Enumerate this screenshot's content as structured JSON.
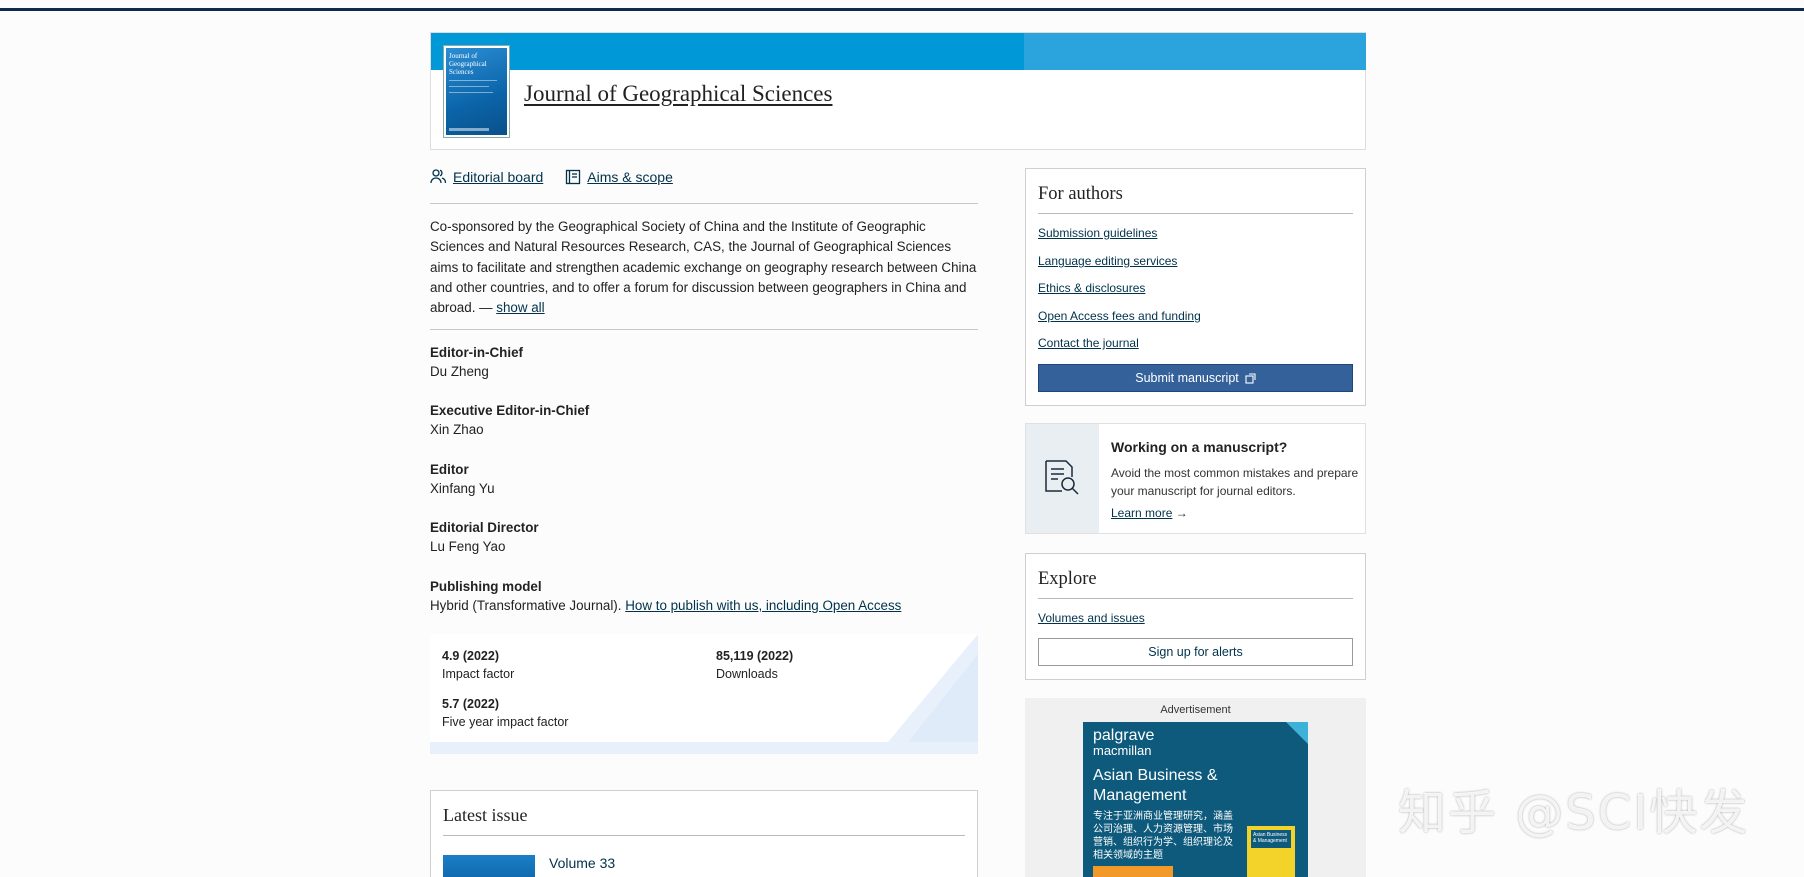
{
  "journal": {
    "title": "Journal of Geographical Sciences",
    "cover_text": "Journal of Geographical Sciences"
  },
  "nav_links": [
    {
      "label": "Editorial board",
      "icon": "people-icon"
    },
    {
      "label": "Aims & scope",
      "icon": "book-icon"
    }
  ],
  "description": {
    "text": "Co-sponsored by the Geographical Society of China and the Institute of Geographic Sciences and Natural Resources Research, CAS, the Journal of Geographical Sciences aims to facilitate and strengthen academic exchange on geography research between China and other countries, and to offer a forum for discussion between geographers in China and abroad. — ",
    "show_all": "show all"
  },
  "editors": [
    {
      "label": "Editor-in-Chief",
      "value": "Du Zheng"
    },
    {
      "label": "Executive Editor-in-Chief",
      "value": "Xin Zhao"
    },
    {
      "label": "Editor",
      "value": "Xinfang Yu"
    },
    {
      "label": "Editorial Director",
      "value": "Lu Feng Yao"
    }
  ],
  "publishing_model": {
    "label": "Publishing model",
    "value": "Hybrid (Transformative Journal). ",
    "link": "How to publish with us, including Open Access"
  },
  "metrics": [
    {
      "value": "4.9 (2022)",
      "label": "Impact factor"
    },
    {
      "value": "85,119 (2022)",
      "label": "Downloads"
    },
    {
      "value": "5.7 (2022)",
      "label": "Five year impact factor"
    }
  ],
  "latest_issue": {
    "heading": "Latest issue",
    "volume": "Volume 33"
  },
  "for_authors": {
    "heading": "For authors",
    "links": [
      "Submission guidelines",
      "Language editing services",
      "Ethics & disclosures",
      "Open Access fees and funding",
      "Contact the journal"
    ],
    "submit_label": "Submit manuscript"
  },
  "working_manuscript": {
    "title": "Working on a manuscript?",
    "text": "Avoid the most common mistakes and prepare your manuscript for journal editors.",
    "learn_more": "Learn more",
    "arrow": "→"
  },
  "explore": {
    "heading": "Explore",
    "link": "Volumes and issues",
    "alerts_label": "Sign up for alerts"
  },
  "advertisement": {
    "label": "Advertisement",
    "brand_line1": "palgrave",
    "brand_line2": "macmillan",
    "headline": "Asian Business & Management",
    "chinese_text": "专注于亚洲商业管理研究，涵盖公司治理、人力资源管理、市场营销、组织行为学、组织理论及相关领域的主题",
    "book_label": "Asian Business & Management"
  },
  "watermark": "知乎 @SCI快发",
  "colors": {
    "header_band": "#0098d6",
    "primary_button": "#35619b",
    "link": "#01324b"
  }
}
